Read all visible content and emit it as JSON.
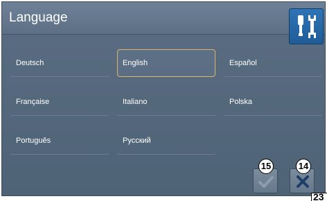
{
  "dialog": {
    "title": "Language"
  },
  "languages": [
    {
      "label": "Deutsch",
      "selected": false
    },
    {
      "label": "English",
      "selected": true
    },
    {
      "label": "Español",
      "selected": false
    },
    {
      "label": "Française",
      "selected": false
    },
    {
      "label": "Italiano",
      "selected": false
    },
    {
      "label": "Polska",
      "selected": false
    },
    {
      "label": "Português",
      "selected": false
    },
    {
      "label": "Русский",
      "selected": false
    }
  ],
  "buttons": {
    "tools_icon": "wrench-screwdriver-icon",
    "confirm_icon": "checkmark-icon",
    "cancel_icon": "close-icon"
  },
  "callouts": {
    "confirm": "15",
    "cancel": "14"
  },
  "figure_number": "23",
  "colors": {
    "panel": "#56697e",
    "accent_blue": "#2668a8",
    "selected_border": "#d9b56a"
  }
}
